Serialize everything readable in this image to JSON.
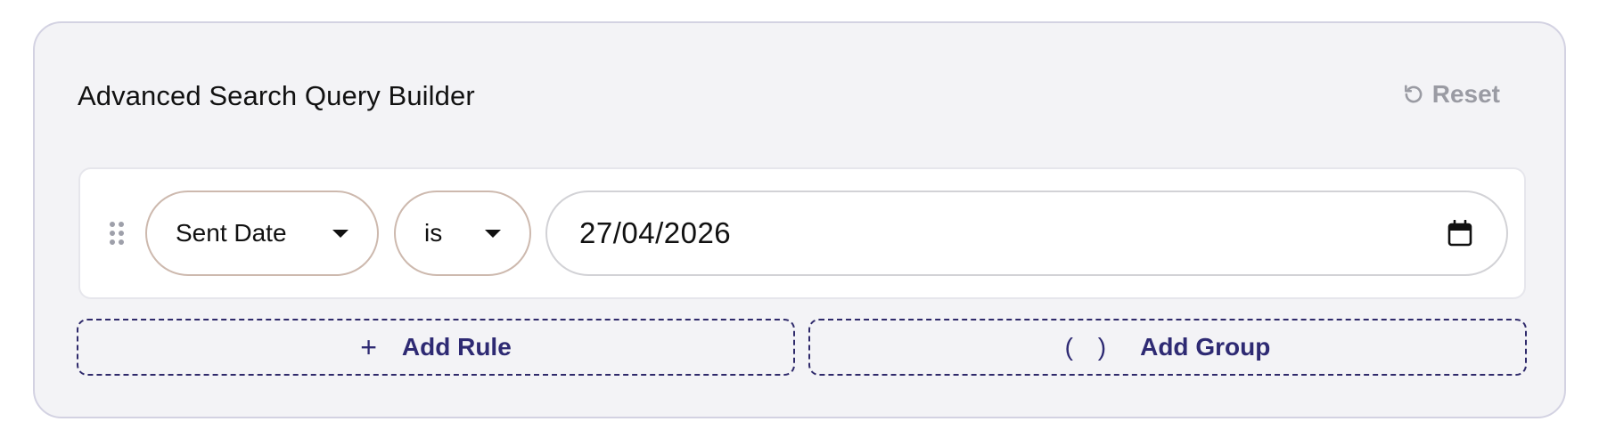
{
  "builder": {
    "title": "Advanced Search Query Builder",
    "reset_label": "Reset"
  },
  "rule": {
    "field": "Sent Date",
    "operator": "is",
    "value": "27/04/2026"
  },
  "actions": {
    "add_rule_label": "Add Rule",
    "add_rule_icon": "+",
    "add_group_label": "Add Group",
    "add_group_icon": "( )"
  },
  "icons": {
    "reset": "reset-icon",
    "drag": "drag-handle-icon",
    "dropdown": "chevron-down-icon",
    "calendar": "calendar-icon"
  },
  "colors": {
    "panel_bg": "#f3f3f6",
    "accent": "#2e2a73",
    "muted": "#9a9ba3",
    "pill_border": "#cdb9ae"
  }
}
